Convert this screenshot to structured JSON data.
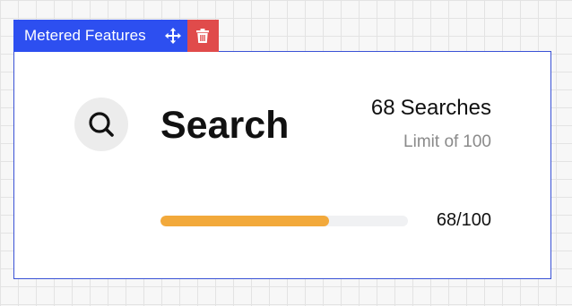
{
  "toolbar": {
    "label": "Metered Features",
    "move_icon": "move-arrows-icon",
    "delete_icon": "trash-icon",
    "accent_color": "#2d4ff0",
    "delete_color": "#e04b4b"
  },
  "feature": {
    "icon": "search-icon",
    "title": "Search",
    "usage_count": "68",
    "usage_unit": "Searches",
    "limit_prefix": "Limit of",
    "limit": "100",
    "progress_text": "68/100",
    "progress_fraction": 0.68,
    "progress_color": "#f2a93b"
  }
}
